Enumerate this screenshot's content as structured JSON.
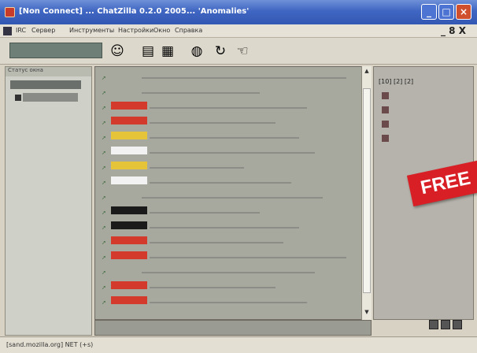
{
  "window": {
    "title": "[Non Connect] ... ChatZilla 0.2.0 2005... 'Anomalies'",
    "min_label": "_",
    "max_label": "□",
    "close_label": "×"
  },
  "menu": {
    "items": [
      "IRC",
      "Сервер",
      "Инструменты",
      "Настройки",
      "Окно",
      "Справка"
    ],
    "mdi_controls": "_ 8 X"
  },
  "toolbar": {
    "icons": [
      "connect-icon",
      "join-icon",
      "list-icon",
      "globe-icon",
      "refresh-icon",
      "hand-icon"
    ]
  },
  "left_pane": {
    "title": "Статус окна"
  },
  "chat": {
    "lines": [
      {
        "nick": "",
        "msg": "",
        "kind": "gray"
      },
      {
        "nick": "",
        "msg": "",
        "kind": "gray"
      },
      {
        "nick": "",
        "msg": "",
        "kind": "red"
      },
      {
        "nick": "",
        "msg": "",
        "kind": "red"
      },
      {
        "nick": "",
        "msg": "",
        "kind": "yellow"
      },
      {
        "nick": "",
        "msg": "",
        "kind": "white"
      },
      {
        "nick": "",
        "msg": "",
        "kind": "yellow"
      },
      {
        "nick": "",
        "msg": "",
        "kind": "white"
      },
      {
        "nick": "",
        "msg": "",
        "kind": "gray"
      },
      {
        "nick": "",
        "msg": "",
        "kind": "dark"
      },
      {
        "nick": "",
        "msg": "",
        "kind": "dark"
      },
      {
        "nick": "",
        "msg": "",
        "kind": "red"
      },
      {
        "nick": "",
        "msg": "",
        "kind": "red"
      },
      {
        "nick": "",
        "msg": "",
        "kind": "gray"
      },
      {
        "nick": "",
        "msg": "",
        "kind": "red"
      },
      {
        "nick": "",
        "msg": "",
        "kind": "red"
      }
    ]
  },
  "right_pane": {
    "count_label": "[10] [2] [2]"
  },
  "badge": {
    "label": "FREE"
  },
  "status": {
    "text": "[sand.mozilla.org] NET (+s)"
  },
  "colors": {
    "titlebar": "#3f66c2",
    "badge": "#d81f26",
    "nick_red": "#d33a2c",
    "nick_yellow": "#e6c43a",
    "nick_white": "#f2f2f2",
    "nick_dark": "#1a1a1a"
  }
}
